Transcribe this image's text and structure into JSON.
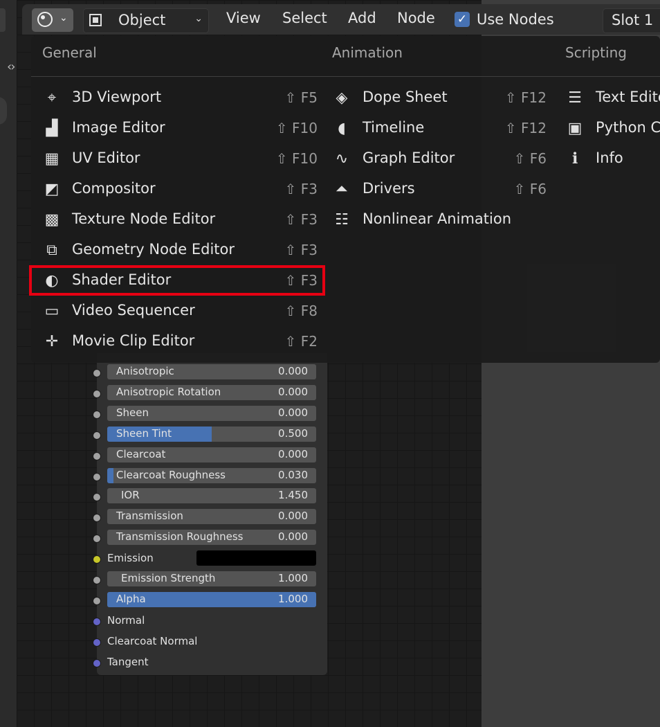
{
  "header": {
    "editor_type_icon": "shader-editor-icon",
    "mode": "Object",
    "menus": [
      "View",
      "Select",
      "Add",
      "Node"
    ],
    "use_nodes_label": "Use Nodes",
    "use_nodes_checked": true,
    "slot": "Slot 1"
  },
  "popup": {
    "general": {
      "title": "General",
      "items": [
        {
          "label": "3D Viewport",
          "shortcut": "⇧ F5",
          "icon": "3d-viewport-icon"
        },
        {
          "label": "Image Editor",
          "shortcut": "⇧ F10",
          "icon": "image-editor-icon"
        },
        {
          "label": "UV Editor",
          "shortcut": "⇧ F10",
          "icon": "uv-editor-icon"
        },
        {
          "label": "Compositor",
          "shortcut": "⇧ F3",
          "icon": "compositor-icon"
        },
        {
          "label": "Texture Node Editor",
          "shortcut": "⇧ F3",
          "icon": "texture-node-editor-icon"
        },
        {
          "label": "Geometry Node Editor",
          "shortcut": "⇧ F3",
          "icon": "geometry-node-editor-icon"
        },
        {
          "label": "Shader Editor",
          "shortcut": "⇧ F3",
          "icon": "shader-editor-icon"
        },
        {
          "label": "Video Sequencer",
          "shortcut": "⇧ F8",
          "icon": "video-sequencer-icon"
        },
        {
          "label": "Movie Clip Editor",
          "shortcut": "⇧ F2",
          "icon": "movie-clip-editor-icon"
        }
      ]
    },
    "animation": {
      "title": "Animation",
      "items": [
        {
          "label": "Dope Sheet",
          "shortcut": "⇧ F12",
          "icon": "dope-sheet-icon"
        },
        {
          "label": "Timeline",
          "shortcut": "⇧ F12",
          "icon": "timeline-icon"
        },
        {
          "label": "Graph Editor",
          "shortcut": "⇧ F6",
          "icon": "graph-editor-icon"
        },
        {
          "label": "Drivers",
          "shortcut": "⇧ F6",
          "icon": "drivers-icon"
        },
        {
          "label": "Nonlinear Animation",
          "shortcut": "",
          "icon": "nonlinear-animation-icon"
        }
      ]
    },
    "scripting": {
      "title": "Scripting",
      "items": [
        {
          "label": "Text Edito",
          "icon": "text-editor-icon"
        },
        {
          "label": "Python C",
          "icon": "python-console-icon"
        },
        {
          "label": "Info",
          "icon": "info-icon"
        }
      ]
    }
  },
  "node": {
    "rows": [
      {
        "label": "Anisotropic",
        "value": "0.000",
        "fill": 0
      },
      {
        "label": "Anisotropic Rotation",
        "value": "0.000",
        "fill": 0
      },
      {
        "label": "Sheen",
        "value": "0.000",
        "fill": 0
      },
      {
        "label": "Sheen Tint",
        "value": "0.500",
        "fill": 0.5
      },
      {
        "label": "Clearcoat",
        "value": "0.000",
        "fill": 0
      },
      {
        "label": "Clearcoat Roughness",
        "value": "0.030",
        "fill": 0.03
      },
      {
        "label": "IOR",
        "value": "1.450",
        "fill": 0
      },
      {
        "label": "Transmission",
        "value": "0.000",
        "fill": 0
      },
      {
        "label": "Transmission Roughness",
        "value": "0.000",
        "fill": 0
      },
      {
        "label": "Emission",
        "color": "#000000"
      },
      {
        "label": "Emission Strength",
        "value": "1.000",
        "fill": 0
      },
      {
        "label": "Alpha",
        "value": "1.000",
        "fill": 1
      },
      {
        "label": "Normal"
      },
      {
        "label": "Clearcoat Normal"
      },
      {
        "label": "Tangent"
      }
    ]
  },
  "colors": {
    "accent": "#4772b3",
    "highlight": "#e60012",
    "socket_grey": "#a1a1a1",
    "socket_yellow": "#c7c729",
    "socket_purple": "#6363c7"
  }
}
